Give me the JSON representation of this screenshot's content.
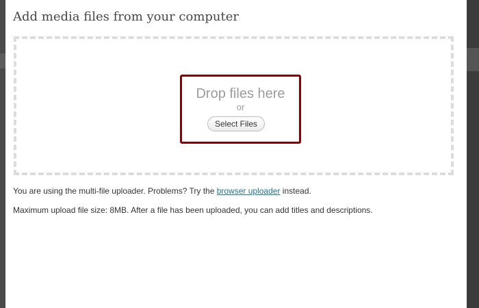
{
  "dialog": {
    "title": "Add media files from your computer"
  },
  "uploader": {
    "drop_text": "Drop files here",
    "or_text": "or",
    "select_button": "Select Files"
  },
  "info": {
    "line1_prefix": "You are using the multi-file uploader. Problems? Try the",
    "browser_uploader_link": "browser uploader",
    "line1_suffix": "instead.",
    "line2": "Maximum upload file size: 8MB. After a file has been uploaded, you can add titles and descriptions."
  },
  "colors": {
    "highlight_border": "#8b0000",
    "link": "#21759b",
    "dashed_border": "#dcdcdc"
  }
}
